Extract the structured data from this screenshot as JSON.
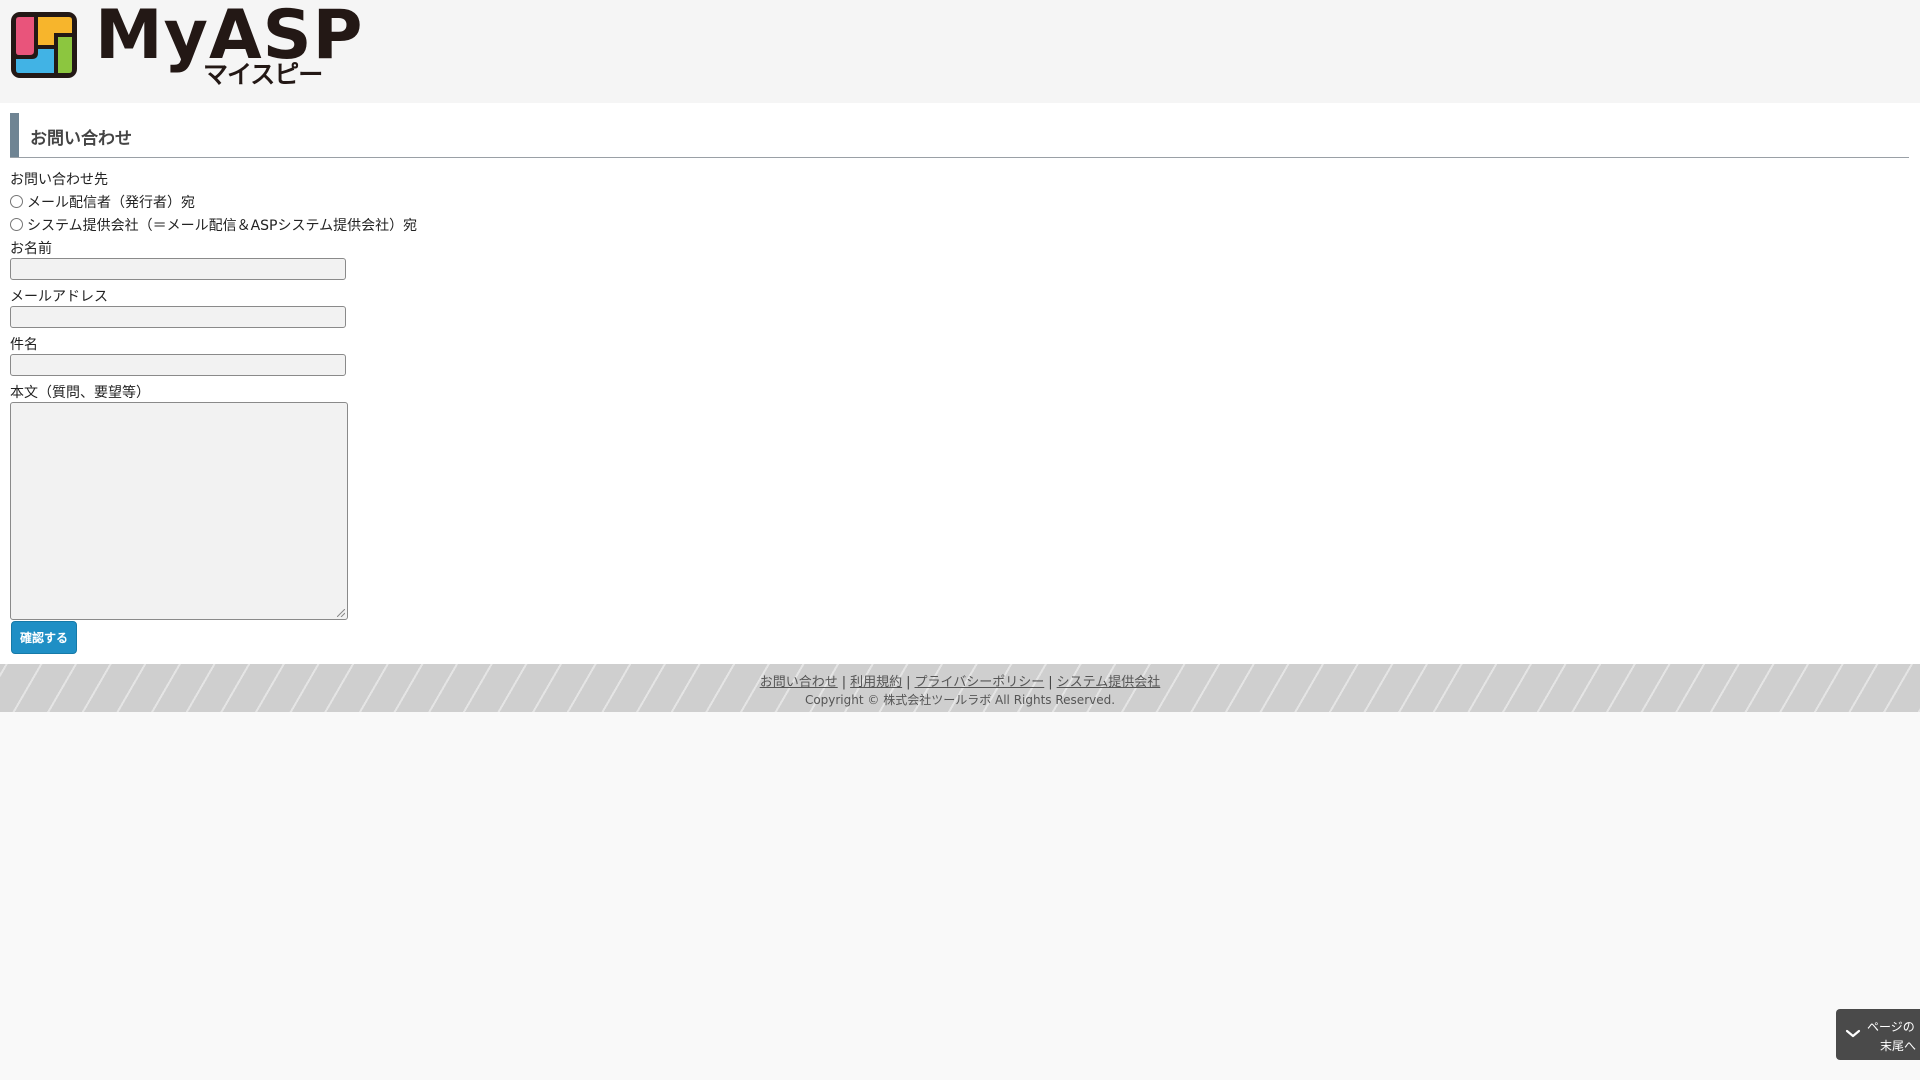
{
  "header": {
    "logo_text": "MyASP",
    "logo_kana": "マイスピー"
  },
  "page": {
    "title": "お問い合わせ"
  },
  "form": {
    "destination_label": "お問い合わせ先",
    "destination_options": [
      {
        "label": "メール配信者（発行者）宛",
        "checked": false
      },
      {
        "label": "システム提供会社（＝メール配信＆ASPシステム提供会社）宛",
        "checked": false
      }
    ],
    "name_label": "お名前",
    "name_value": "",
    "email_label": "メールアドレス",
    "email_value": "",
    "subject_label": "件名",
    "subject_value": "",
    "body_label": "本文（質問、要望等）",
    "body_value": "",
    "confirm_label": "確認する"
  },
  "footer": {
    "links": [
      {
        "label": "お問い合わせ"
      },
      {
        "label": "利用規約"
      },
      {
        "label": "プライバシーポリシー"
      },
      {
        "label": "システム提供会社"
      }
    ],
    "separator": "|",
    "copyright": "Copyright © 株式会社ツールラボ All Rights Reserved."
  },
  "scroll_to_bottom": {
    "line1": "ページの",
    "line2": "末尾へ",
    "icon": "chevron-down-icon"
  },
  "colors": {
    "title_bar": "#6f8493",
    "confirm_button": "#1f8fc5",
    "logo_dark": "#231815"
  }
}
